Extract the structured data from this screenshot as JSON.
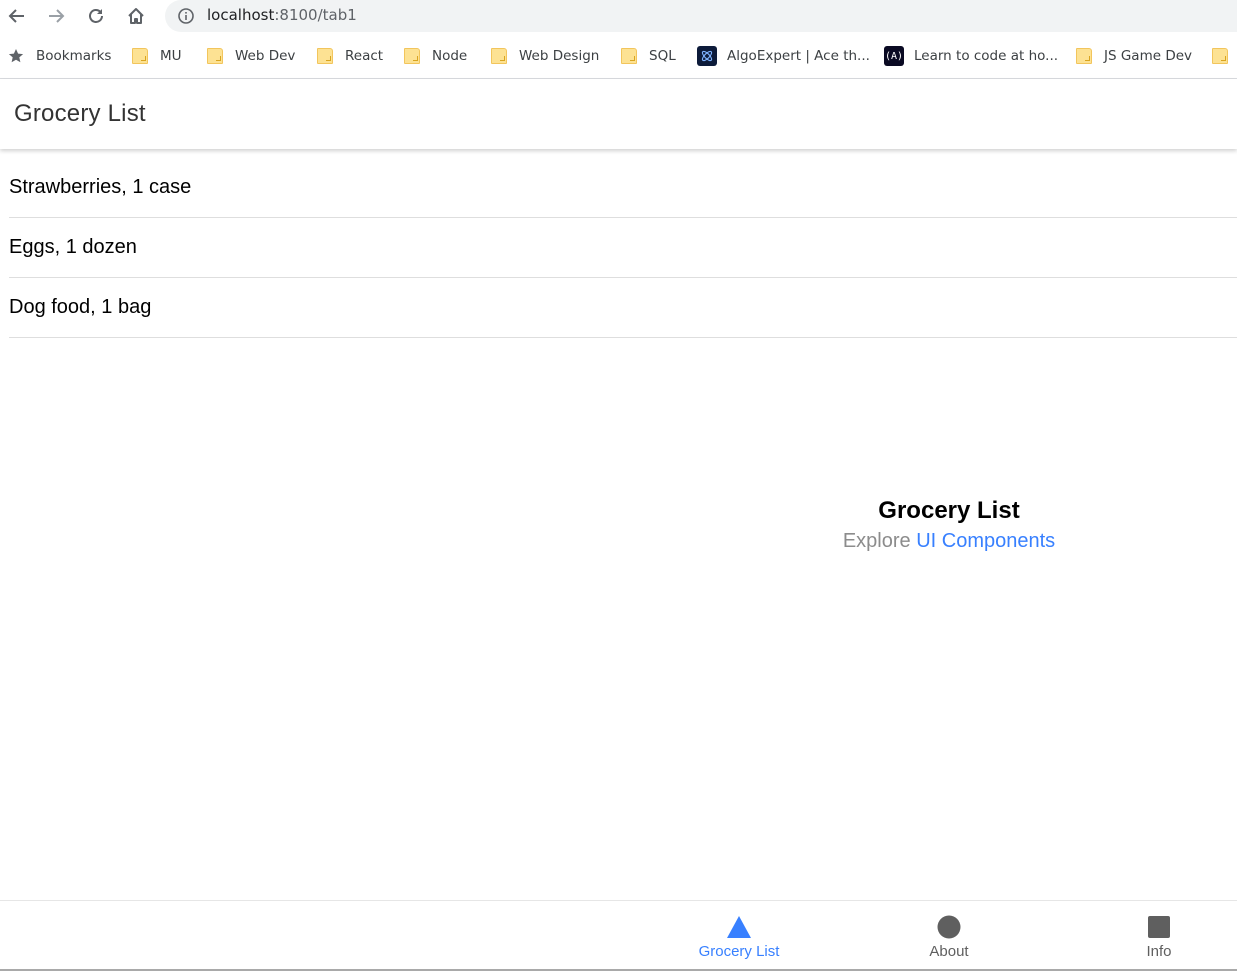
{
  "browser": {
    "url_host": "localhost",
    "url_path": ":8100/tab1",
    "nav": {
      "back_icon": "arrow-left-icon",
      "forward_icon": "arrow-right-icon",
      "reload_icon": "reload-icon",
      "home_icon": "home-icon",
      "site_info_icon": "info-icon"
    },
    "bookmarks": [
      {
        "label": "Bookmarks",
        "icon": "star-icon"
      },
      {
        "label": "MU",
        "icon": "folder-icon"
      },
      {
        "label": "Web Dev",
        "icon": "folder-icon"
      },
      {
        "label": "React",
        "icon": "folder-icon"
      },
      {
        "label": "Node",
        "icon": "folder-icon"
      },
      {
        "label": "Web Design",
        "icon": "folder-icon"
      },
      {
        "label": "SQL",
        "icon": "folder-icon"
      },
      {
        "label": "AlgoExpert | Ace th...",
        "icon": "algoexpert-icon"
      },
      {
        "label": "Learn to code at ho...",
        "icon": "freecodecamp-icon"
      },
      {
        "label": "JS Game Dev",
        "icon": "folder-icon"
      }
    ]
  },
  "header": {
    "title": "Grocery List"
  },
  "grocery_items": [
    "Strawberries, 1 case",
    "Eggs, 1 dozen",
    "Dog food, 1 bag"
  ],
  "explore": {
    "title": "Grocery List",
    "prefix": "Explore",
    "link": "UI Components"
  },
  "tabs": [
    {
      "label": "Grocery List",
      "icon": "triangle-icon",
      "active": true
    },
    {
      "label": "About",
      "icon": "ellipse-icon",
      "active": false
    },
    {
      "label": "Info",
      "icon": "square-icon",
      "active": false
    }
  ],
  "colors": {
    "primary": "#3880ff",
    "tab_inactive": "#5f5f5f",
    "folder": "#fde293"
  }
}
